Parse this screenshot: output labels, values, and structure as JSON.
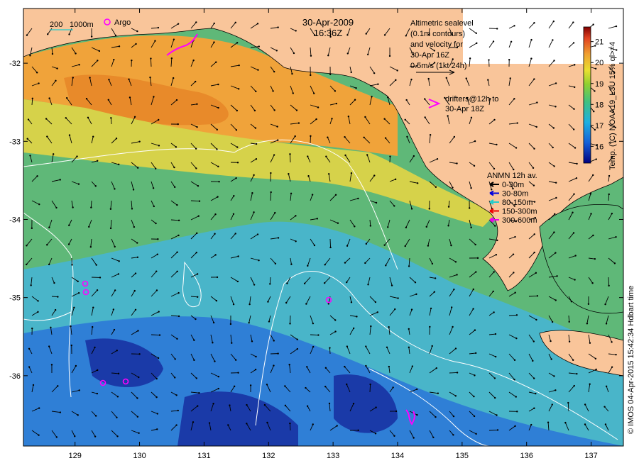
{
  "title": {
    "date": "30-Apr-2009",
    "time": "16:36Z"
  },
  "scale_bar": {
    "label_a": "200",
    "label_b": "1000m",
    "argo_label": "Argo"
  },
  "altimetry_note": {
    "lines": [
      "Altimetric sealevel",
      "(0.1m contours)",
      "and velocity for",
      "30-Apr 16Z",
      "0.5m/s (1kt 24h)"
    ]
  },
  "drifter_note": {
    "lines": [
      "drifters@12h to",
      "30-Apr 18Z"
    ]
  },
  "anmn_legend": {
    "title": "ANMN 12h av.",
    "items": [
      {
        "label": "0-30m",
        "color": "#000000"
      },
      {
        "label": "30-80m",
        "color": "#0000dd"
      },
      {
        "label": "80-150m",
        "color": "#22cccc"
      },
      {
        "label": "150-300m",
        "color": "#ee0000"
      },
      {
        "label": "300-600m",
        "color": "#ee00ee"
      }
    ]
  },
  "colorbar": {
    "title": "Temp. (°C) NOAA19_L3U 15% ql>=4",
    "min": 15.2,
    "max": 21.7,
    "ticks": [
      "16",
      "17",
      "18",
      "19",
      "20",
      "21"
    ],
    "tick_values": [
      16,
      17,
      18,
      19,
      20,
      21
    ]
  },
  "x_axis": {
    "ticks": [
      "129",
      "130",
      "131",
      "132",
      "133",
      "134",
      "135",
      "136",
      "137"
    ],
    "values": [
      129,
      130,
      131,
      132,
      133,
      134,
      135,
      136,
      137
    ],
    "range": [
      128.2,
      137.5
    ]
  },
  "y_axis": {
    "ticks": [
      "-32",
      "-33",
      "-34",
      "-35",
      "-36"
    ],
    "values": [
      -32,
      -33,
      -34,
      -35,
      -36
    ],
    "range": [
      -36.9,
      -31.3
    ]
  },
  "credit": "© IMOS 04-Apr-2015 15:42:34 Hdbart time",
  "colors": {
    "land": "#f9c59a",
    "frame": "#000000",
    "contour": "#ffffff"
  }
}
